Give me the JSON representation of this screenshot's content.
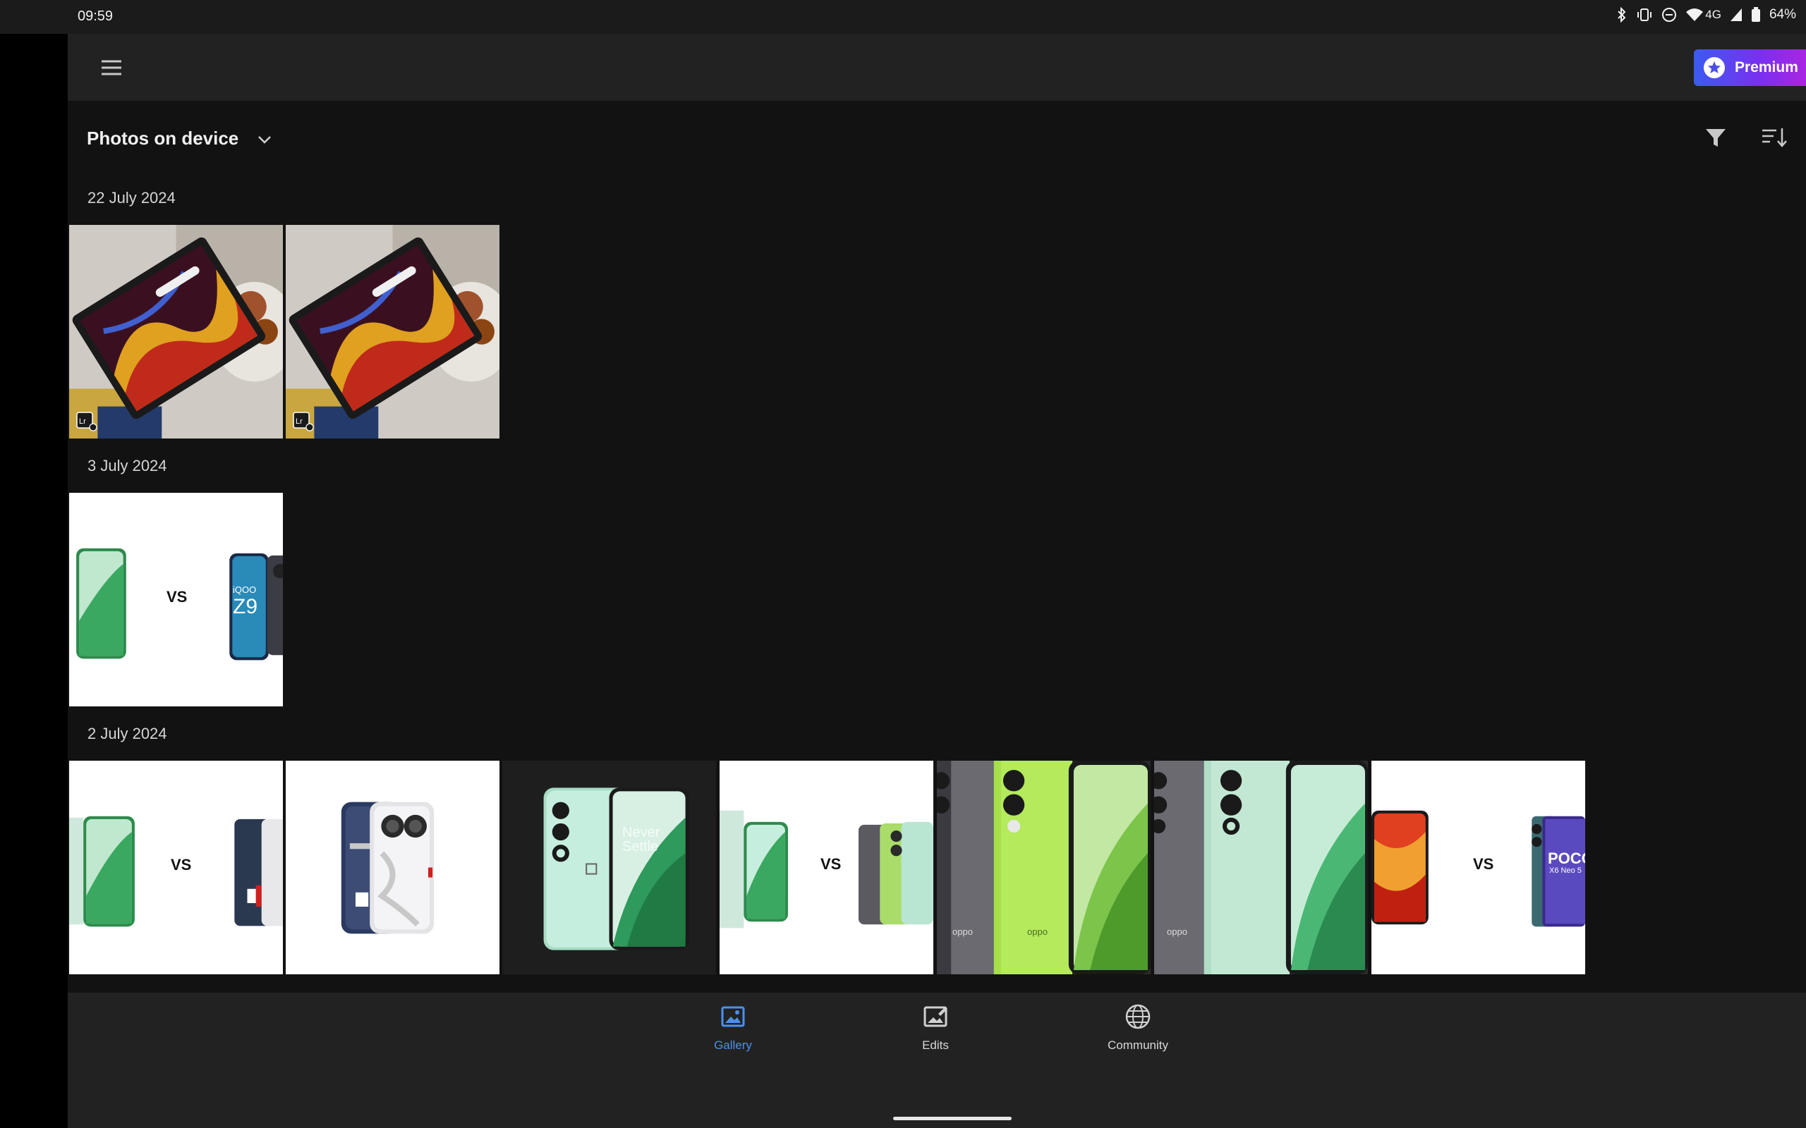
{
  "status_bar": {
    "time": "09:59",
    "network": "4G",
    "battery": "64%",
    "icons": [
      "bluetooth-icon",
      "vibrate-icon",
      "do-not-disturb-icon",
      "wifi-icon",
      "signal-icon",
      "battery-icon"
    ]
  },
  "app_bar": {
    "menu_icon": "hamburger-menu-icon",
    "premium_label": "Premium",
    "premium_colors": [
      "#3b5bf0",
      "#b324e0"
    ],
    "more_icon": "more-vertical-icon"
  },
  "gallery": {
    "album_title": "Photos on device",
    "album_dropdown_icon": "chevron-down-icon",
    "filter_icon": "filter-icon",
    "sort_icon": "sort-icon",
    "sections": [
      {
        "date": "22 July 2024",
        "photos": [
          "tablet-photo",
          "tablet-photo"
        ]
      },
      {
        "date": "3 July 2024",
        "photos": [
          "phone-comparison-vs"
        ]
      },
      {
        "date": "2 July 2024",
        "photos": [
          "phone-comparison-vs",
          "nothing-phone-photo",
          "oneplus-phone-photo",
          "phone-comparison-vs",
          "oppo-phones-green",
          "oppo-phones-mint",
          "poco-comparison-vs"
        ]
      }
    ],
    "vs_text": "VS",
    "z9_text": "Z9",
    "iqoo_text": "iQOO",
    "poco_text": "POCO",
    "poco_sub": "X6 Neo 5",
    "oppo_text": "oppo",
    "never_settle_text": "Never Settle"
  },
  "bottom_nav": {
    "items": [
      {
        "label": "Gallery",
        "icon": "gallery-icon",
        "active": true
      },
      {
        "label": "Edits",
        "icon": "edits-icon",
        "active": false
      },
      {
        "label": "Community",
        "icon": "globe-icon",
        "active": false
      }
    ],
    "accent": "#4a90f0"
  }
}
